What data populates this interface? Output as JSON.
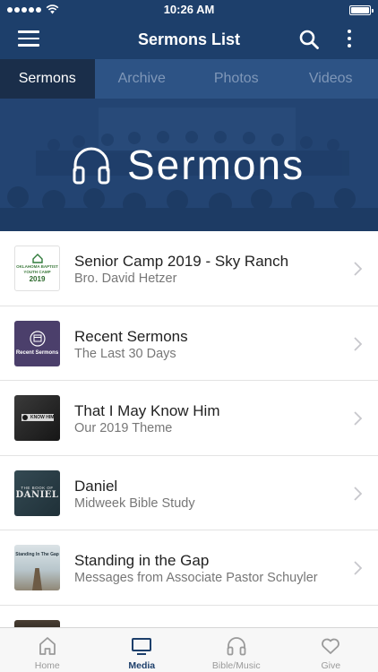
{
  "status_bar": {
    "time": "10:26 AM"
  },
  "nav": {
    "title": "Sermons List"
  },
  "tabs": [
    {
      "label": "Sermons",
      "active": true
    },
    {
      "label": "Archive",
      "active": false
    },
    {
      "label": "Photos",
      "active": false
    },
    {
      "label": "Videos",
      "active": false
    }
  ],
  "banner": {
    "title": "Sermons"
  },
  "series": [
    {
      "title": "Senior Camp 2019 - Sky Ranch",
      "subtitle": "Bro. David Hetzer",
      "thumb_text": [
        "OKLAHOMA BAPTIST",
        "YOUTH CAMP",
        "2019"
      ]
    },
    {
      "title": "Recent Sermons",
      "subtitle": "The Last 30 Days",
      "thumb_text": [
        "Recent Sermons"
      ]
    },
    {
      "title": "That I May Know Him",
      "subtitle": "Our 2019 Theme",
      "thumb_text": [
        "KNOW HIM"
      ]
    },
    {
      "title": "Daniel",
      "subtitle": "Midweek Bible Study",
      "thumb_text": [
        "THE BOOK OF",
        "DANIEL"
      ]
    },
    {
      "title": "Standing in the Gap",
      "subtitle": "Messages from Associate Pastor Schuyler",
      "thumb_text": [
        "Standing In The Gap"
      ]
    }
  ],
  "tab_bar": [
    {
      "label": "Home",
      "icon": "home-icon",
      "active": false
    },
    {
      "label": "Media",
      "icon": "tv-icon",
      "active": true
    },
    {
      "label": "Bible/Music",
      "icon": "headphones-icon",
      "active": false
    },
    {
      "label": "Give",
      "icon": "heart-icon",
      "active": false
    }
  ],
  "colors": {
    "primary": "#1d3f6b",
    "tab_bg": "#2d5385",
    "tab_active_bg": "#1a2e4a"
  }
}
